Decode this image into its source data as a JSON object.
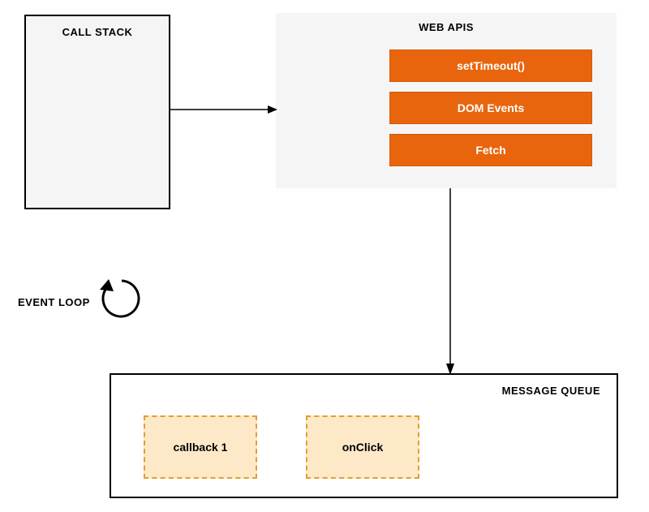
{
  "callStack": {
    "title": "CALL STACK"
  },
  "webApis": {
    "title": "WEB APIS",
    "items": [
      "setTimeout()",
      "DOM Events",
      "Fetch"
    ]
  },
  "eventLoop": {
    "label": "EVENT LOOP"
  },
  "messageQueue": {
    "title": "MESSAGE QUEUE",
    "items": [
      "callback 1",
      "onClick"
    ]
  },
  "colors": {
    "apiBg": "#e8650d",
    "queueBg": "#fde9c8",
    "queueBorder": "#e0a030",
    "panelBg": "#f5f5f5"
  }
}
